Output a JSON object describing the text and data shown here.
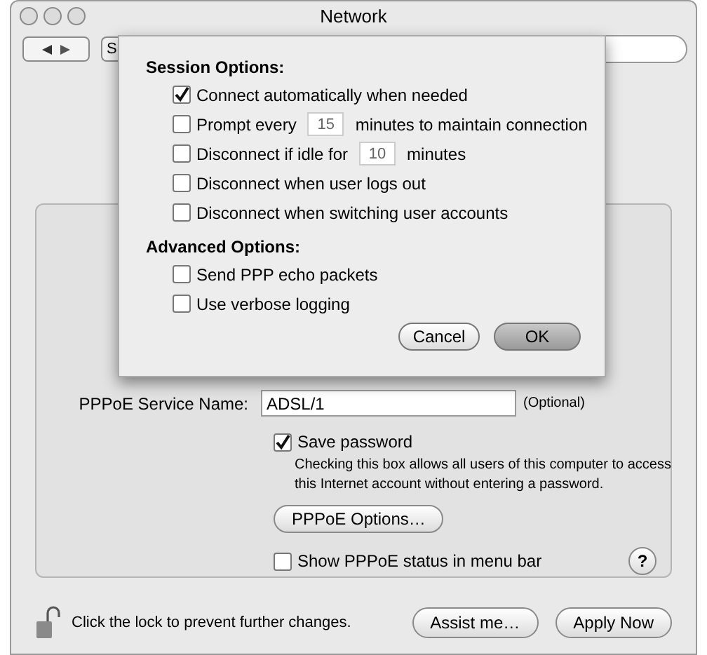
{
  "window": {
    "title": "Network"
  },
  "toolbar": {
    "show_all_button": "S"
  },
  "sheet": {
    "sections": [
      {
        "heading": "Session Options:",
        "options": [
          {
            "kind": "plain",
            "label": "Connect automatically when needed",
            "checked": true
          },
          {
            "kind": "field",
            "label": "Prompt every",
            "value": "15",
            "suffix": "minutes to maintain connection",
            "checked": false
          },
          {
            "kind": "field",
            "label": "Disconnect if idle for",
            "value": "10",
            "suffix": "minutes",
            "checked": false
          },
          {
            "kind": "plain",
            "label": "Disconnect when user logs out",
            "checked": false
          },
          {
            "kind": "plain",
            "label": "Disconnect when switching user accounts",
            "checked": false
          }
        ]
      },
      {
        "heading": "Advanced Options:",
        "options": [
          {
            "kind": "plain",
            "label": "Send PPP echo packets",
            "checked": false
          },
          {
            "kind": "plain",
            "label": "Use verbose logging",
            "checked": false
          }
        ]
      }
    ],
    "buttons": [
      {
        "label": "Cancel",
        "default": false
      },
      {
        "label": "OK",
        "default": true
      }
    ]
  },
  "form": {
    "service_name": {
      "label": "PPPoE Service Name:",
      "value": "ADSL/1",
      "note": "(Optional)"
    },
    "save_password": {
      "label": "Save password",
      "checked": true,
      "description": "Checking this box allows all users of this computer to access this Internet account without entering a password."
    },
    "options_button": "PPPoE Options…",
    "show_status": {
      "label": "Show PPPoE status in menu bar",
      "checked": false
    },
    "help": "?"
  },
  "footer": {
    "lock_text": "Click the lock to prevent further changes.",
    "buttons": [
      "Assist me…",
      "Apply Now"
    ]
  }
}
